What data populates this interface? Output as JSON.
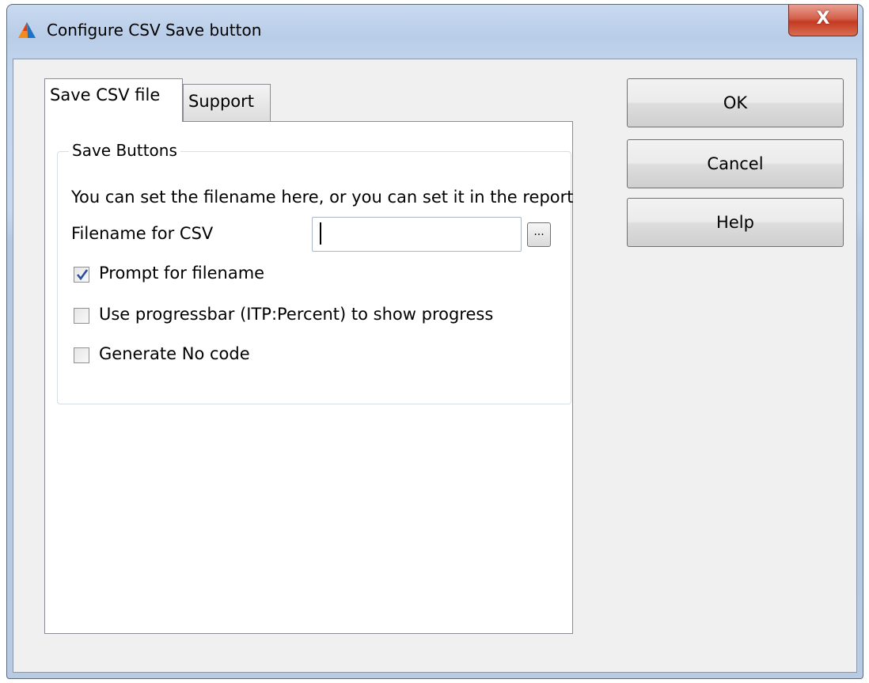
{
  "window": {
    "title": "Configure CSV Save button",
    "close_label": "X"
  },
  "tabs": [
    {
      "label": "Save CSV file",
      "active": true
    },
    {
      "label": "Support",
      "active": false
    }
  ],
  "save_buttons_group": {
    "legend": "Save Buttons",
    "info_text": "You can set the filename here, or you can set it in the report",
    "filename_label": "Filename for CSV",
    "filename_value": "",
    "browse_label": "...",
    "checkboxes": [
      {
        "label": "Prompt for filename",
        "checked": true
      },
      {
        "label": "Use progressbar (ITP:Percent) to show progress",
        "checked": false
      },
      {
        "label": "Generate No code",
        "checked": false
      }
    ]
  },
  "buttons": {
    "ok": "OK",
    "cancel": "Cancel",
    "help": "Help"
  },
  "icons": {
    "app": "app-logo-icon",
    "close": "close-icon",
    "check": "checkmark-icon"
  },
  "colors": {
    "close_button": "#c43a22",
    "checkmark": "#2a4f9b"
  }
}
